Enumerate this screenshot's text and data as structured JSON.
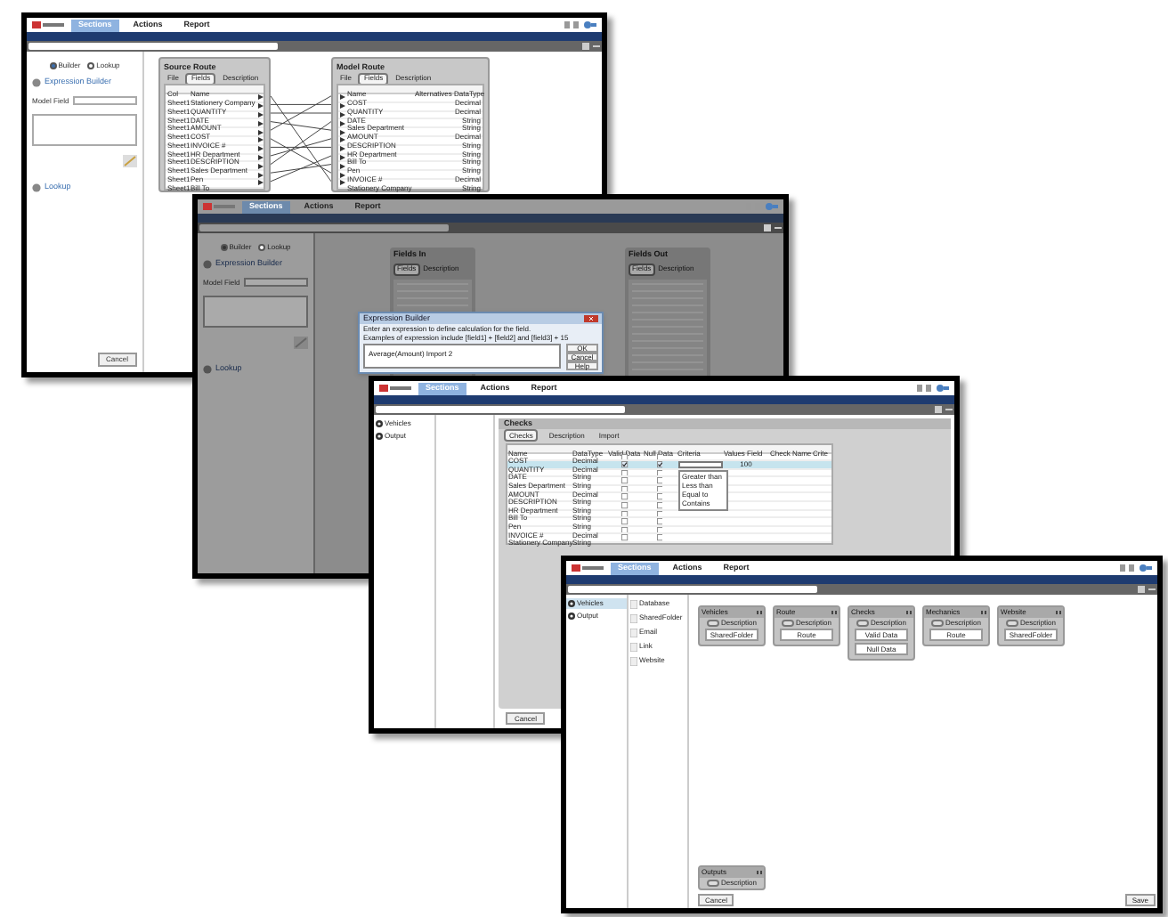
{
  "windows": [
    {
      "kind": "mapping",
      "menu": [
        {
          "label": "Sections",
          "selected": true
        },
        {
          "label": "Actions",
          "selected": false
        },
        {
          "label": "Report",
          "selected": false
        }
      ],
      "mode_options": [
        {
          "label": "Builder",
          "selected": true
        },
        {
          "label": "Lookup",
          "selected": false
        }
      ],
      "expression_section": "Expression Builder",
      "model_field_label": "Model Field",
      "lookup_section": "Lookup",
      "cancel_button": "Cancel",
      "source_panel": {
        "title": "Source Route",
        "tabs": [
          {
            "label": "File",
            "selected": false
          },
          {
            "label": "Fields",
            "selected": true
          },
          {
            "label": "Description",
            "selected": false
          }
        ],
        "columns": [
          "Col",
          "Name"
        ],
        "rows": [
          [
            "Sheet1",
            "Stationery Company"
          ],
          [
            "Sheet1",
            "QUANTITY"
          ],
          [
            "Sheet1",
            "DATE"
          ],
          [
            "Sheet1",
            "AMOUNT"
          ],
          [
            "Sheet1",
            "COST"
          ],
          [
            "Sheet1",
            "INVOICE #"
          ],
          [
            "Sheet1",
            "HR Department"
          ],
          [
            "Sheet1",
            "DESCRIPTION"
          ],
          [
            "Sheet1",
            "Sales Department"
          ],
          [
            "Sheet1",
            "Pen"
          ],
          [
            "Sheet1",
            "Bill To"
          ]
        ]
      },
      "model_panel": {
        "title": "Model Route",
        "tabs": [
          {
            "label": "File",
            "selected": false
          },
          {
            "label": "Fields",
            "selected": true
          },
          {
            "label": "Description",
            "selected": false
          }
        ],
        "columns": [
          "Name",
          "Alternatives",
          "DataType"
        ],
        "rows": [
          [
            "COST",
            "",
            "Decimal"
          ],
          [
            "QUANTITY",
            "",
            "Decimal"
          ],
          [
            "DATE",
            "",
            "String"
          ],
          [
            "Sales Department",
            "",
            "String"
          ],
          [
            "AMOUNT",
            "",
            "Decimal"
          ],
          [
            "DESCRIPTION",
            "",
            "String"
          ],
          [
            "HR Department",
            "",
            "String"
          ],
          [
            "Bill To",
            "",
            "String"
          ],
          [
            "Pen",
            "",
            "String"
          ],
          [
            "INVOICE #",
            "",
            "Decimal"
          ],
          [
            "Stationery Company",
            "",
            "String"
          ]
        ]
      }
    },
    {
      "kind": "expression",
      "menu": [
        {
          "label": "Sections",
          "selected": true
        },
        {
          "label": "Actions",
          "selected": false
        },
        {
          "label": "Report",
          "selected": false
        }
      ],
      "mode_options": [
        {
          "label": "Builder",
          "selected": true
        },
        {
          "label": "Lookup",
          "selected": false
        }
      ],
      "expression_section": "Expression Builder",
      "model_field_label": "Model Field",
      "lookup_section": "Lookup",
      "panels": [
        {
          "title": "Fields In",
          "tabs": [
            {
              "label": "Fields",
              "selected": true
            },
            {
              "label": "Description",
              "selected": false
            }
          ]
        },
        {
          "title": "Fields Out",
          "tabs": [
            {
              "label": "Fields",
              "selected": true
            },
            {
              "label": "Description",
              "selected": false
            }
          ]
        }
      ],
      "dialog": {
        "title": "Expression Builder",
        "instruction": "Enter an expression to define calculation for the field.",
        "example": "Examples of expression include [field1] + [field2] and [field3] + 15",
        "value": "Average(Amount) Import 2",
        "buttons": [
          "OK",
          "Cancel",
          "Help"
        ]
      }
    },
    {
      "kind": "checks",
      "menu": [
        {
          "label": "Sections",
          "selected": true
        },
        {
          "label": "Actions",
          "selected": false
        },
        {
          "label": "Report",
          "selected": false
        }
      ],
      "sidebar": [
        {
          "label": "Vehicles",
          "selected": false
        },
        {
          "label": "Output",
          "selected": false
        }
      ],
      "panel_title": "Checks",
      "tabs": [
        {
          "label": "Checks",
          "selected": true
        },
        {
          "label": "Description",
          "selected": false
        },
        {
          "label": "Import",
          "selected": false
        }
      ],
      "columns": [
        "Name",
        "DataType",
        "Valid Data",
        "Null Data",
        "Criteria",
        "Values Field",
        "Check Name",
        "Crite"
      ],
      "rows": [
        {
          "name": "COST",
          "type": "Decimal",
          "valid": false,
          "null": false,
          "selected": false,
          "value": ""
        },
        {
          "name": "QUANTITY",
          "type": "Decimal",
          "valid": true,
          "null": true,
          "selected": true,
          "value": "100"
        },
        {
          "name": "DATE",
          "type": "String",
          "valid": false,
          "null": false,
          "selected": false,
          "value": ""
        },
        {
          "name": "Sales Department",
          "type": "String",
          "valid": false,
          "null": false,
          "selected": false,
          "value": ""
        },
        {
          "name": "AMOUNT",
          "type": "Decimal",
          "valid": false,
          "null": false,
          "selected": false,
          "value": ""
        },
        {
          "name": "DESCRIPTION",
          "type": "String",
          "valid": false,
          "null": false,
          "selected": false,
          "value": ""
        },
        {
          "name": "HR Department",
          "type": "String",
          "valid": false,
          "null": false,
          "selected": false,
          "value": ""
        },
        {
          "name": "Bill To",
          "type": "String",
          "valid": false,
          "null": false,
          "selected": false,
          "value": ""
        },
        {
          "name": "Pen",
          "type": "String",
          "valid": false,
          "null": false,
          "selected": false,
          "value": ""
        },
        {
          "name": "INVOICE #",
          "type": "Decimal",
          "valid": false,
          "null": false,
          "selected": false,
          "value": ""
        },
        {
          "name": "Stationery Company",
          "type": "String",
          "valid": false,
          "null": false,
          "selected": false,
          "value": ""
        }
      ],
      "criteria_options": [
        "Greater than",
        "Less than",
        "Equal to",
        "Contains"
      ],
      "cancel_button": "Cancel"
    },
    {
      "kind": "canvas",
      "menu": [
        {
          "label": "Sections",
          "selected": true
        },
        {
          "label": "Actions",
          "selected": false
        },
        {
          "label": "Report",
          "selected": false
        }
      ],
      "sidebar": [
        {
          "label": "Vehicles",
          "selected": true
        },
        {
          "label": "Output",
          "selected": false
        }
      ],
      "palette": [
        "Database",
        "SharedFolder",
        "Email",
        "Link",
        "Website"
      ],
      "cards": [
        {
          "title": "Vehicles",
          "on": false,
          "description": "Description",
          "buttons": [
            "SharedFolder"
          ]
        },
        {
          "title": "Route",
          "on": false,
          "description": "Description",
          "buttons": [
            "Route"
          ]
        },
        {
          "title": "Checks",
          "on": false,
          "description": "Description",
          "buttons": [
            "Valid Data",
            "Null Data"
          ]
        },
        {
          "title": "Mechanics",
          "on": false,
          "description": "Description",
          "buttons": [
            "Route"
          ]
        },
        {
          "title": "Website",
          "on": false,
          "description": "Description",
          "buttons": [
            "SharedFolder"
          ]
        }
      ],
      "bottom_card": {
        "title": "Outputs",
        "on": false,
        "description": "Description"
      },
      "cancel_button": "Cancel",
      "save_button": "Save"
    }
  ]
}
